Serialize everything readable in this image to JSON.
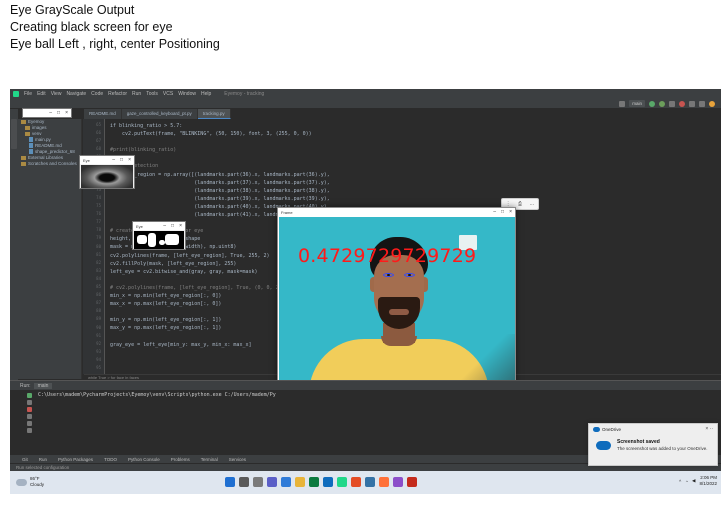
{
  "headings": [
    "Eye GrayScale Output",
    "Creating black screen for eye",
    "Eye ball Left , right, center Positioning"
  ],
  "ide": {
    "menu": [
      "File",
      "Edit",
      "View",
      "Navigate",
      "Code",
      "Refactor",
      "Run",
      "Tools",
      "VCS",
      "Window",
      "Help"
    ],
    "project_title": "Eyemoy - tracking",
    "run_config": "main",
    "tabs": [
      "README.md",
      "gaze_controlled_keyboard_pt.py",
      "tracking.py"
    ],
    "project_tree": [
      "Eyemoy",
      "images",
      "venv",
      "main.py",
      "README.md",
      "shape_predictor_68",
      "External Libraries",
      "Scratches and Consoles"
    ],
    "line_numbers": [
      "65",
      "66",
      "67",
      "68",
      "69",
      "70",
      "71",
      "72",
      "73",
      "74",
      "75",
      "76",
      "77",
      "78",
      "79",
      "80",
      "81",
      "82",
      "83",
      "84",
      "85",
      "86",
      "87",
      "88",
      "89",
      "90",
      "91",
      "92",
      "93",
      "94",
      "95"
    ],
    "code_lines": [
      "if blinking_ratio > 5.7:",
      "    cv2.putText(frame, \"BLINKING\", (50, 150), font, 3, (255, 0, 0))",
      "",
      "#print(blinking_ratio)",
      "",
      "# Gaze detection",
      "left_eye_region = np.array([(landmarks.part(36).x, landmarks.part(36).y),",
      "                            (landmarks.part(37).x, landmarks.part(37).y),",
      "                            (landmarks.part(38).x, landmarks.part(38).y),",
      "                            (landmarks.part(39).x, landmarks.part(39).y),",
      "                            (landmarks.part(40).x, landmarks.part(40).y),",
      "                            (landmarks.part(41).x, landmarks.part(41).y)], np.int32)",
      "",
      "# create a black screen for eye",
      "height, width, _ = frame.shape",
      "mask = np.zeros((height, width), np.uint8)",
      "cv2.polylines(frame, [left_eye_region], True, 255, 2)",
      "cv2.fillPoly(mask, [left_eye_region], 255)",
      "left_eye = cv2.bitwise_and(gray, gray, mask=mask)",
      "",
      "# cv2.polylines(frame, [left_eye_region], True, (0, 0, 255), 2)",
      "min_x = np.min(left_eye_region[:, 0])",
      "max_x = np.max(left_eye_region[:, 0])",
      "",
      "min_y = np.min(left_eye_region[:, 1])",
      "max_y = np.max(left_eye_region[:, 1])",
      "",
      "gray_eye = left_eye[min_y: max_y, min_x: max_x]"
    ],
    "breadcrumb": "while True  >  for face in faces",
    "run_label": "Run:",
    "run_tab": "main",
    "command": "C:\\Users\\madem\\PycharmProjects\\Eyemoy\\venv\\Scripts\\python.exe C:/Users/madem/Py",
    "bottom_tabs": [
      "Git",
      "Run",
      "Python Packages",
      "TODO",
      "Python Console",
      "Problems",
      "Terminal",
      "Services"
    ],
    "status": "Run selected configuration"
  },
  "windows": {
    "eye_gray_title": "Eye",
    "frame_title": "Frame",
    "ratio_text": "0.4729729729729"
  },
  "notification": {
    "app": "OneDrive",
    "title": "Screenshot saved",
    "body": "The screenshot was added to your OneDrive."
  },
  "taskbar": {
    "temp": "86°F",
    "condition": "Cloudy",
    "time": "2:06 PM",
    "date": "8/1/2022"
  },
  "colors": {
    "ratio_text": "#ff1a1a",
    "eye_outline": "#2f49ff",
    "wall": "#35b8c8",
    "shirt": "#f1cd5a",
    "ide_bg": "#2b2b2b"
  }
}
